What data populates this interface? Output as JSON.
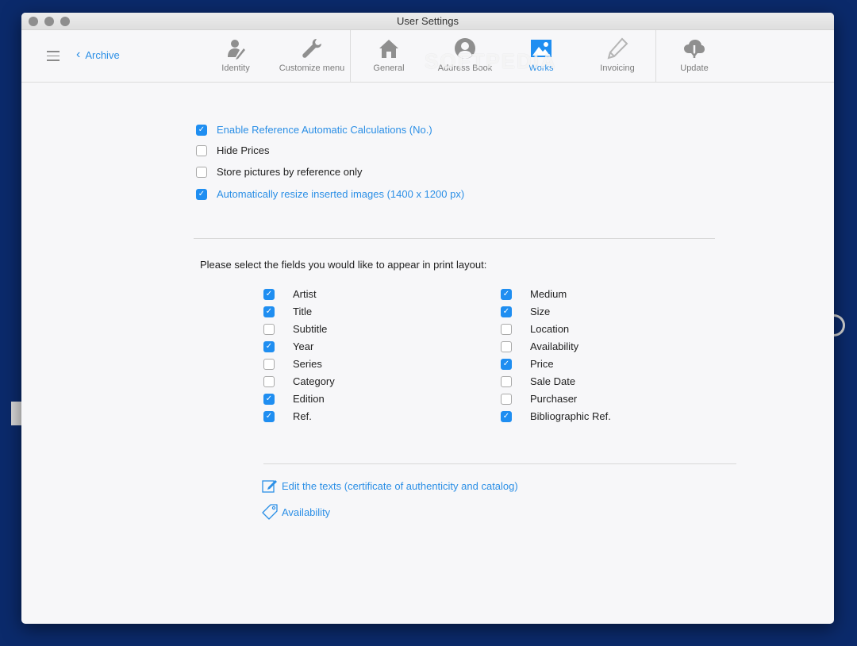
{
  "window": {
    "title": "User Settings"
  },
  "watermark": "SOFTPEDIA",
  "nav": {
    "back_label": "Archive"
  },
  "tabs": [
    {
      "label": "Identity",
      "icon": "identity-icon",
      "active": false
    },
    {
      "label": "Customize menu",
      "icon": "wrench-icon",
      "active": false
    },
    {
      "label": "General",
      "icon": "home-icon",
      "active": false
    },
    {
      "label": "Address Book",
      "icon": "person-icon",
      "active": false
    },
    {
      "label": "Works",
      "icon": "image-icon",
      "active": true
    },
    {
      "label": "Invoicing",
      "icon": "pencil-icon",
      "active": false
    },
    {
      "label": "Update",
      "icon": "cloud-download-icon",
      "active": false
    }
  ],
  "options": [
    {
      "label": "Enable Reference Automatic Calculations (No.)",
      "checked": true
    },
    {
      "label": "Hide Prices",
      "checked": false
    },
    {
      "label": "Store pictures by reference only",
      "checked": false
    },
    {
      "label": "Automatically resize inserted images (1400 x 1200 px)",
      "checked": true
    }
  ],
  "print_prompt": "Please select the fields you would like to appear in print layout:",
  "fields_left": [
    {
      "label": "Artist",
      "checked": true
    },
    {
      "label": "Title",
      "checked": true
    },
    {
      "label": "Subtitle",
      "checked": false
    },
    {
      "label": "Year",
      "checked": true
    },
    {
      "label": "Series",
      "checked": false
    },
    {
      "label": "Category",
      "checked": false
    },
    {
      "label": "Edition",
      "checked": true
    },
    {
      "label": "Ref.",
      "checked": true
    }
  ],
  "fields_right": [
    {
      "label": "Medium",
      "checked": true
    },
    {
      "label": "Size",
      "checked": true
    },
    {
      "label": "Location",
      "checked": false
    },
    {
      "label": "Availability",
      "checked": false
    },
    {
      "label": "Price",
      "checked": true
    },
    {
      "label": "Sale Date",
      "checked": false
    },
    {
      "label": "Purchaser",
      "checked": false
    },
    {
      "label": "Bibliographic Ref.",
      "checked": true
    }
  ],
  "links": {
    "edit_texts": "Edit the texts (certificate of authenticity and catalog)",
    "availability": "Availability"
  },
  "colors": {
    "accent": "#2b8fe6",
    "checkbox_on": "#1f8ef1",
    "desktop": "#0b2a6b"
  }
}
